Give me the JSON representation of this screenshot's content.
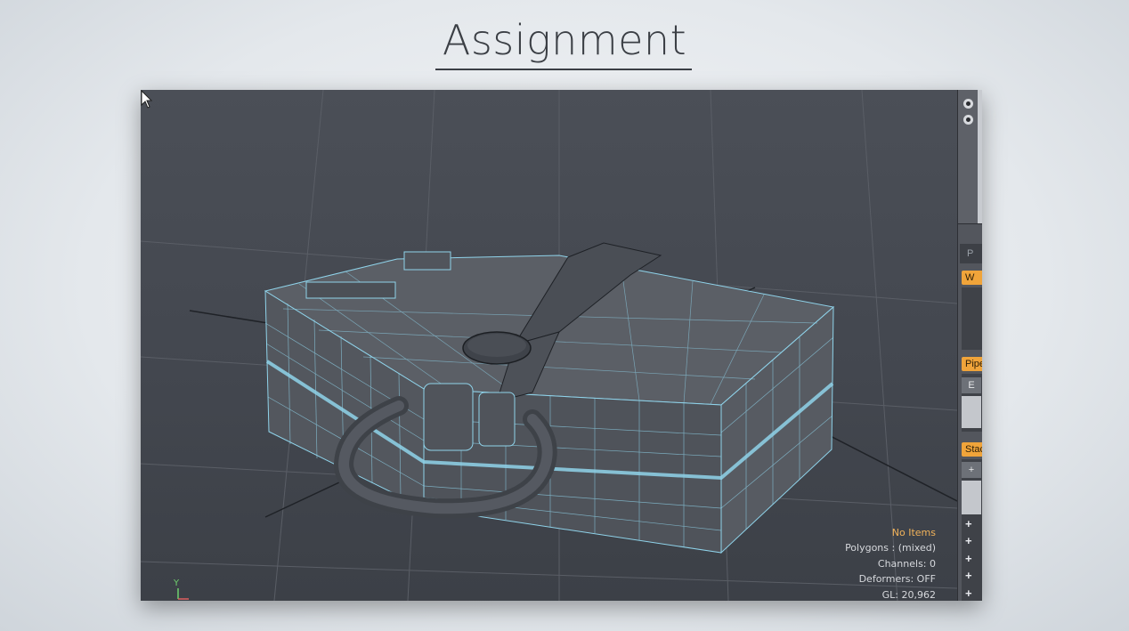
{
  "slide": {
    "title": "Assignment"
  },
  "viewport": {
    "hud": {
      "selection": "No Items",
      "polygons": "Polygons : (mixed)",
      "channels": "Channels: 0",
      "deformers": "Deformers: OFF",
      "gl": "GL: 20,962"
    },
    "axis_label": "Y"
  },
  "side_panel": {
    "tab_label": "P",
    "tag_w": "W",
    "tag_pipe": "Pipeline",
    "button_e": "E",
    "tag_stack": "Stack",
    "button_add": "+",
    "plus_items": [
      "+",
      "+",
      "+",
      "+",
      "+"
    ]
  },
  "colors": {
    "accent": "#f0a43a",
    "viewport_bg": "#454950",
    "wire": "#8fd3ea"
  }
}
